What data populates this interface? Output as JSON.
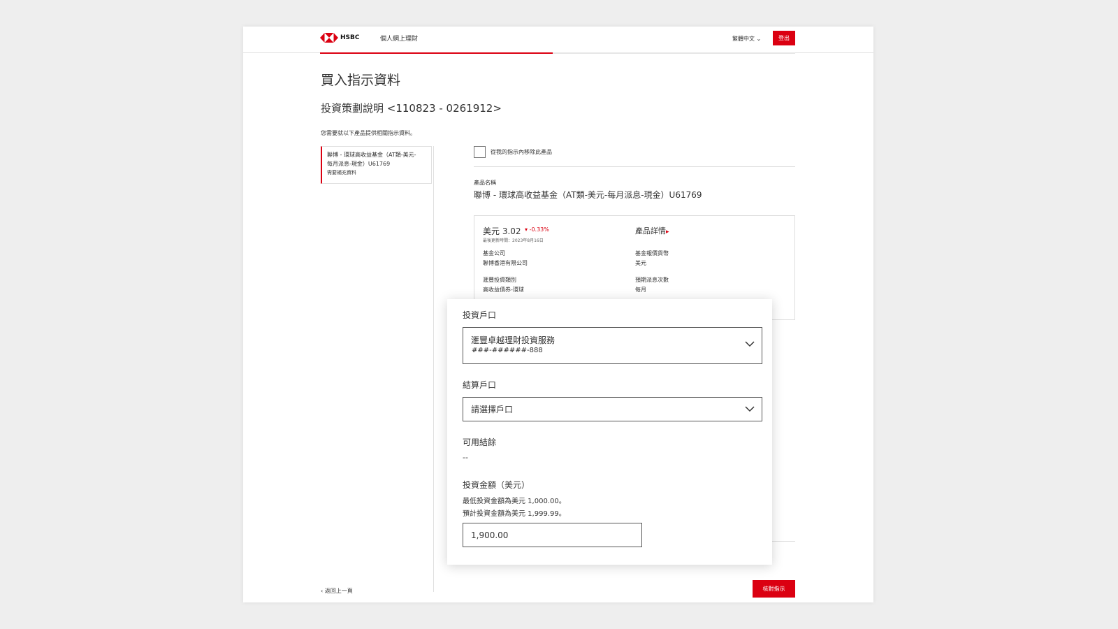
{
  "header": {
    "brand": "HSBC",
    "nav_link": "個人網上理財",
    "language": "繁體中文",
    "logout": "登出"
  },
  "progress_percent": 49,
  "page": {
    "title": "買入指示資料",
    "subtitle": "投資策劃說明 <110823 - 0261912>",
    "hint": "您需要就以下產品提供相關指示資料。"
  },
  "side_card": {
    "line1": "聯博 - 環球高收益基金（AT類-美元-",
    "line2": "每月派息-現金）U61769",
    "status": "需要補充資料"
  },
  "product": {
    "remove_label": "從我的指示內移除此產品",
    "name_label": "產品名稱",
    "name": "聯博 - 環球高收益基金（AT類-美元-每月派息-現金）U61769",
    "price": "美元 3.02",
    "change": "-0.33%",
    "price_date": "最後更新時間：2023年8月16日",
    "details_link": "產品詳情",
    "fund_house_label": "基金公司",
    "fund_house": "聯博香港有限公司",
    "currency_label": "基金報價貨幣",
    "currency": "美元",
    "category_label": "滙豐投資類別",
    "category": "高收益債券-環球",
    "dividend_label": "預期派息次數",
    "dividend": "每月"
  },
  "form": {
    "investment_account_label": "投資戶口",
    "investment_account": "滙豐卓越理財投資服務",
    "investment_account_number": "###-######-888",
    "settlement_account_label": "結算戶口",
    "settlement_placeholder": "請選擇戶口",
    "available_balance_label": "可用結餘",
    "available_balance": "--",
    "amount_label": "投資金額（美元）",
    "min_note": "最低投資金額為美元 1,000.00。",
    "max_note": "預計投資金額為美元 1,999.99。",
    "amount_value": "1,900.00"
  },
  "footer": {
    "back": "返回上一頁",
    "confirm": "核對指示"
  },
  "colors": {
    "brand_red": "#db0011"
  }
}
